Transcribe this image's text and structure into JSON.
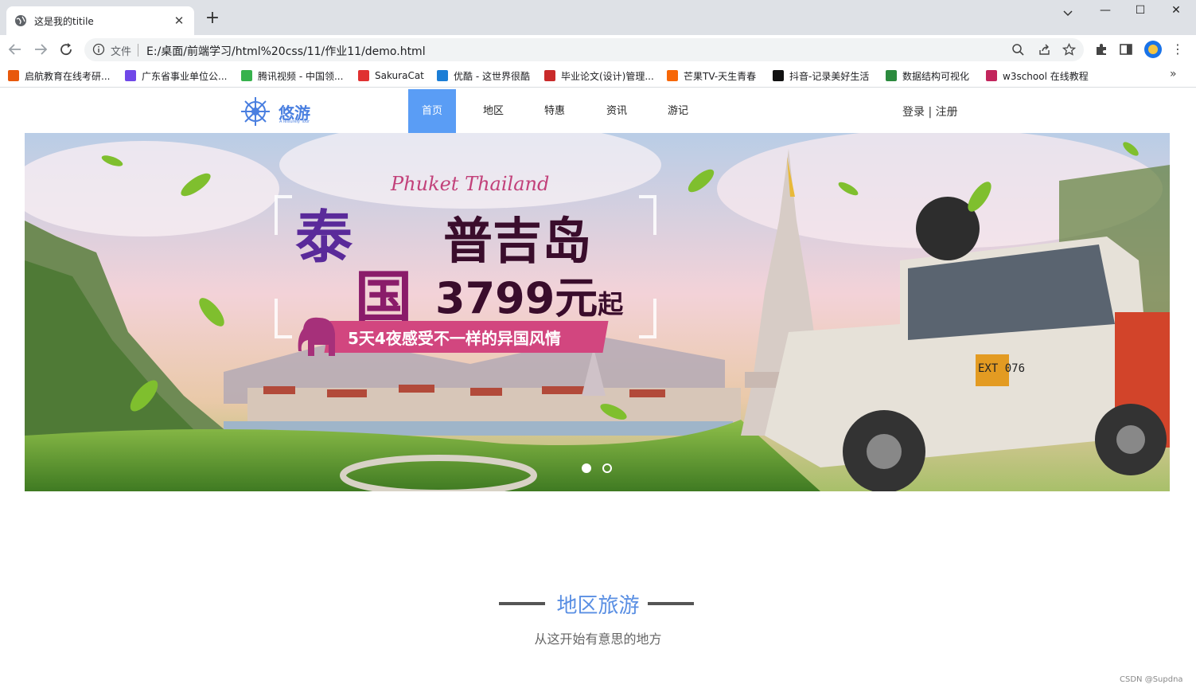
{
  "browser": {
    "tab_title": "这是我的titile",
    "url_scheme_label": "文件",
    "url": "E:/桌面/前端学习/html%20css/11/作业11/demo.html",
    "bookmarks": [
      {
        "label": "启航教育在线考研...",
        "color": "#e8590c"
      },
      {
        "label": "广东省事业单位公...",
        "color": "#7048e8"
      },
      {
        "label": "腾讯视频 - 中国领...",
        "color": "#37b24d"
      },
      {
        "label": "SakuraCat",
        "color": "#e03131"
      },
      {
        "label": "优酷 - 这世界很酷",
        "color": "#1c7ed6"
      },
      {
        "label": "毕业论文(设计)管理...",
        "color": "#c92a2a"
      },
      {
        "label": "芒果TV-天生青春",
        "color": "#f76707"
      },
      {
        "label": "抖音-记录美好生活",
        "color": "#111111"
      },
      {
        "label": "数据结构可视化",
        "color": "#2b8a3e"
      },
      {
        "label": "w3school 在线教程",
        "color": "#c2255c"
      }
    ]
  },
  "site": {
    "logo_text": "悠游",
    "logo_sub": "A leisurely Tour",
    "nav": [
      "首页",
      "地区",
      "特惠",
      "资讯",
      "游记"
    ],
    "active_nav": "首页",
    "auth": "登录 | 注册",
    "accent": "#5a9df5"
  },
  "banner": {
    "script": "Phuket Thailand",
    "tai": "泰",
    "guo": "国",
    "island": "普吉岛",
    "price": "3799元",
    "price_suffix": "起",
    "tagline": "5天4夜感受不一样的异国风情",
    "plate": "EXT 076",
    "slides": 2,
    "current_slide": 1
  },
  "section": {
    "title": "地区旅游",
    "subtitle": "从这开始有意思的地方"
  },
  "watermark": "CSDN @Supdna"
}
